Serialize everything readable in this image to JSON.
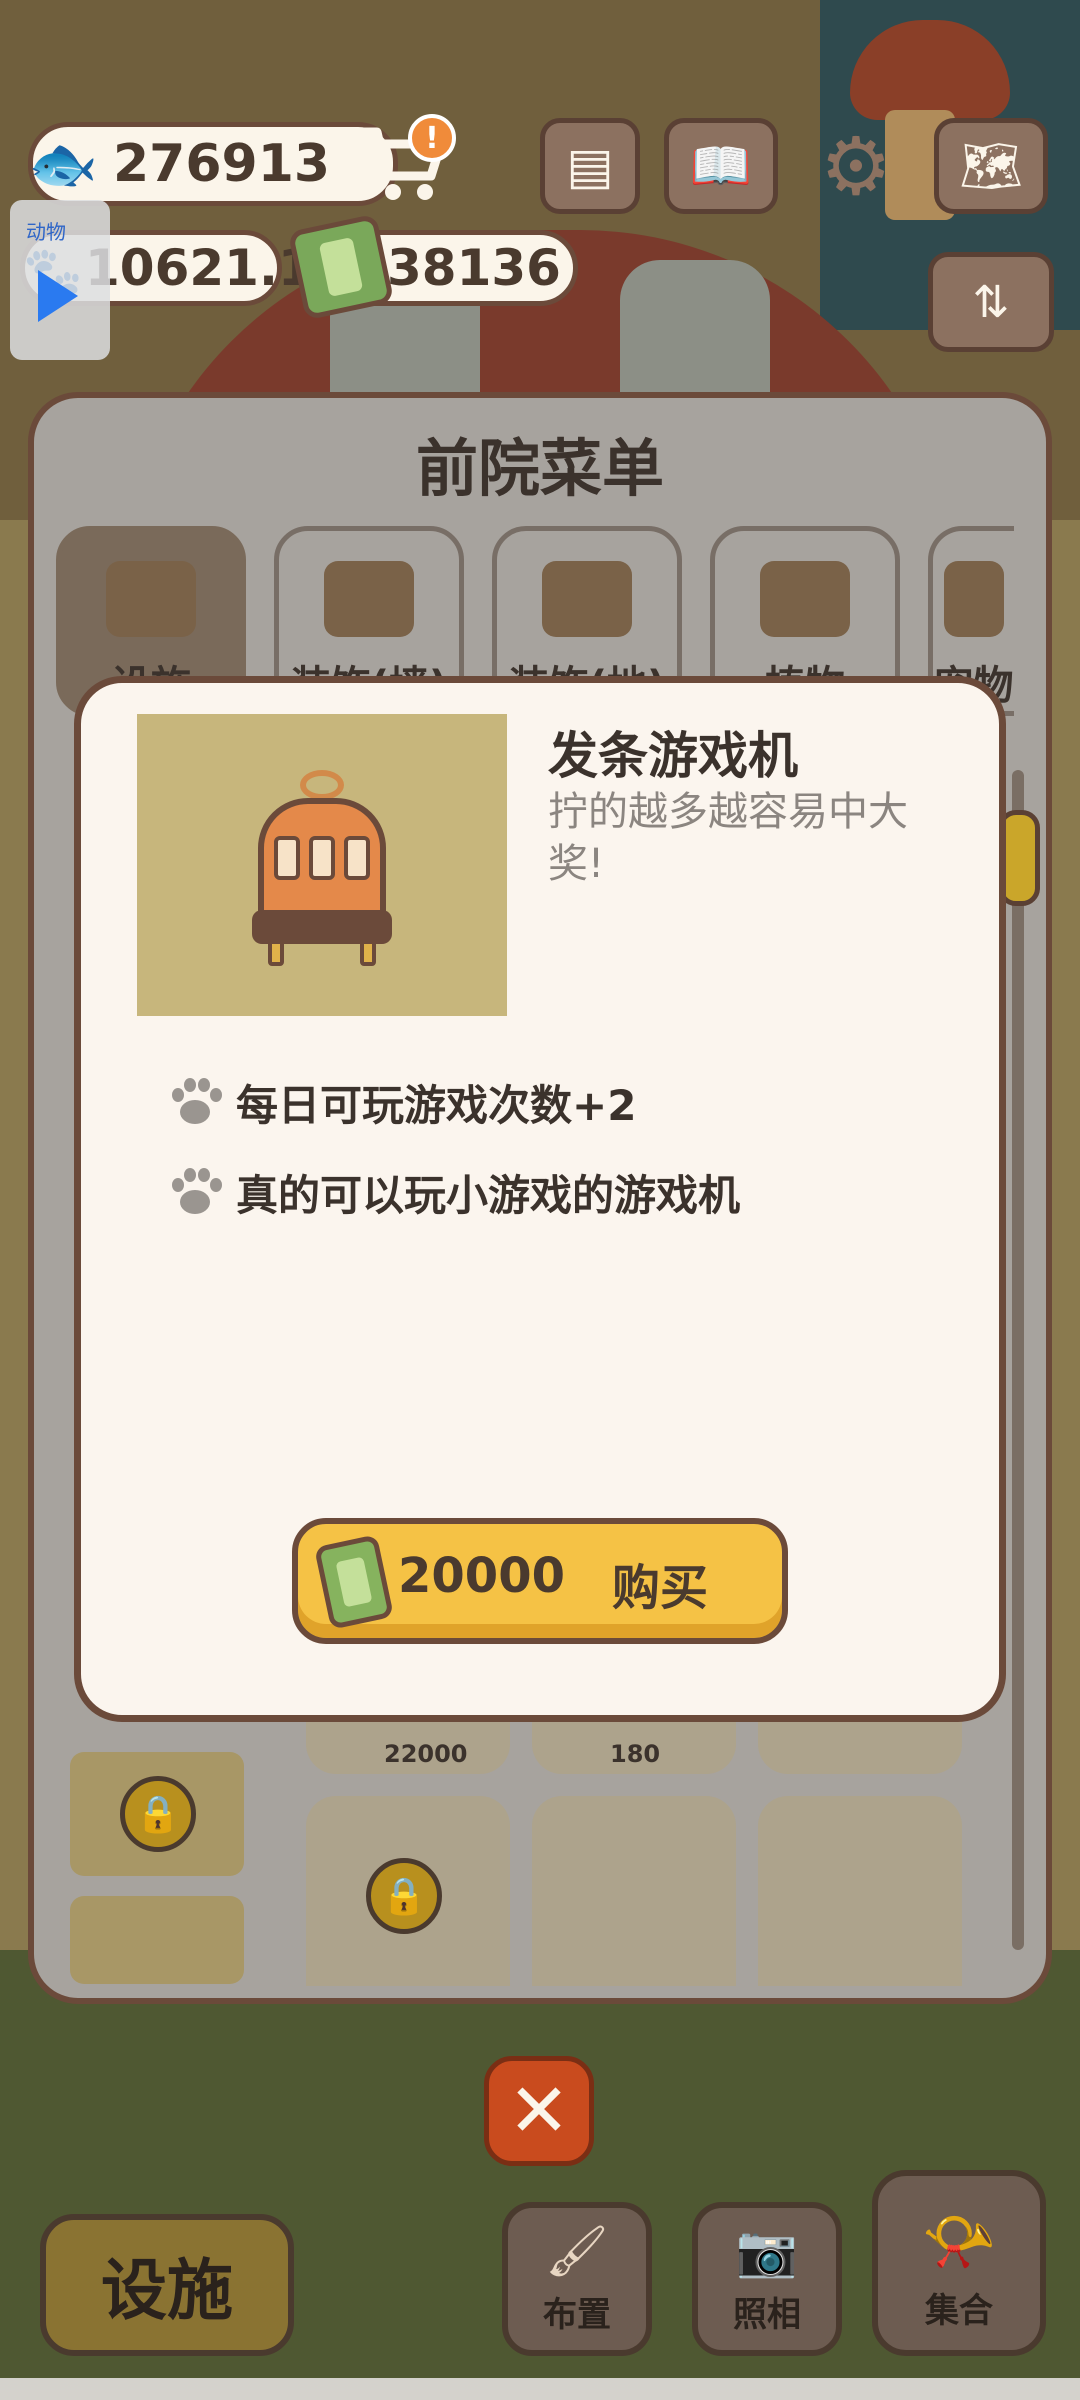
{
  "hud": {
    "fish_count": "276913",
    "paw_value": "10621.1",
    "ticket_count": "38136",
    "cart_alert": "!",
    "video_widget_label": "动物"
  },
  "menu": {
    "title": "前院菜单",
    "tabs": [
      {
        "label": "设施",
        "icon": "fence-icon",
        "active": true
      },
      {
        "label": "装饰(墙)",
        "icon": "wall-decor-icon",
        "active": false
      },
      {
        "label": "装饰(地)",
        "icon": "floor-decor-icon",
        "active": false
      },
      {
        "label": "植物",
        "icon": "plant-icon",
        "active": false
      },
      {
        "label": "宠物",
        "icon": "pet-icon",
        "active": false
      }
    ],
    "card_prices": [
      "22000",
      "180"
    ]
  },
  "dialog": {
    "item_name": "发条游戏机",
    "item_description": "拧的越多越容易中大奖!",
    "features": [
      "每日可玩游戏次数+2",
      "真的可以玩小游戏的游戏机"
    ],
    "price": "20000",
    "buy_label": "购买"
  },
  "bottom_nav": {
    "facilities": "设施",
    "arrange": "布置",
    "photo": "照相",
    "gather": "集合"
  },
  "colors": {
    "accent_yellow": "#f5c245",
    "dialog_bg": "#fbf5ee",
    "border_brown": "#6b4a3a",
    "close_red": "#c94b1e"
  }
}
